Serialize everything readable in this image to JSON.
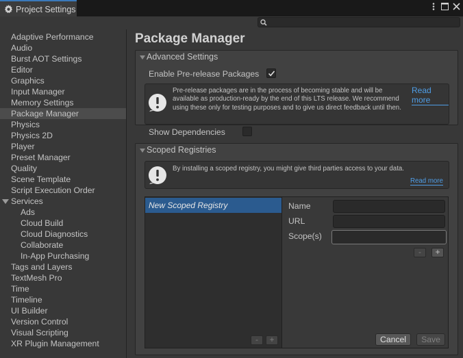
{
  "window": {
    "tab_title": "Project Settings",
    "icons": [
      "more-options-icon",
      "maximize-icon",
      "close-icon"
    ]
  },
  "search": {
    "placeholder": "",
    "value": ""
  },
  "sidebar": {
    "items": [
      {
        "label": "Adaptive Performance"
      },
      {
        "label": "Audio"
      },
      {
        "label": "Burst AOT Settings"
      },
      {
        "label": "Editor"
      },
      {
        "label": "Graphics"
      },
      {
        "label": "Input Manager"
      },
      {
        "label": "Memory Settings"
      },
      {
        "label": "Package Manager",
        "selected": true
      },
      {
        "label": "Physics"
      },
      {
        "label": "Physics 2D"
      },
      {
        "label": "Player"
      },
      {
        "label": "Preset Manager"
      },
      {
        "label": "Quality"
      },
      {
        "label": "Scene Template"
      },
      {
        "label": "Script Execution Order"
      },
      {
        "label": "Services",
        "expanded": true
      },
      {
        "label": "Ads",
        "sub": true
      },
      {
        "label": "Cloud Build",
        "sub": true
      },
      {
        "label": "Cloud Diagnostics",
        "sub": true
      },
      {
        "label": "Collaborate",
        "sub": true
      },
      {
        "label": "In-App Purchasing",
        "sub": true
      },
      {
        "label": "Tags and Layers"
      },
      {
        "label": "TextMesh Pro"
      },
      {
        "label": "Time"
      },
      {
        "label": "Timeline"
      },
      {
        "label": "UI Builder"
      },
      {
        "label": "Version Control"
      },
      {
        "label": "Visual Scripting"
      },
      {
        "label": "XR Plugin Management"
      }
    ]
  },
  "main": {
    "title": "Package Manager",
    "advanced": {
      "header": "Advanced Settings",
      "prerelease_label": "Enable Pre-release Packages",
      "prerelease_checked": true,
      "help_text": "Pre-release packages are in the process of becoming stable and will be available as production-ready by the end of this LTS release. We recommend using these only for testing purposes and to give us direct feedback until then.",
      "read_more": "Read more",
      "show_deps_label": "Show Dependencies",
      "show_deps_checked": false
    },
    "scoped": {
      "header": "Scoped Registries",
      "help_text": "By installing a scoped registry, you might give third parties access to your data.",
      "read_more": "Read more",
      "registries": [
        {
          "name": "New Scoped Registry",
          "selected": true
        }
      ],
      "list_remove": "-",
      "list_add": "+",
      "fields": {
        "name_label": "Name",
        "name_value": "",
        "url_label": "URL",
        "url_value": "",
        "scopes_label": "Scope(s)",
        "scopes_value": ""
      },
      "scope_remove": "-",
      "scope_add": "+",
      "cancel": "Cancel",
      "save": "Save"
    }
  }
}
